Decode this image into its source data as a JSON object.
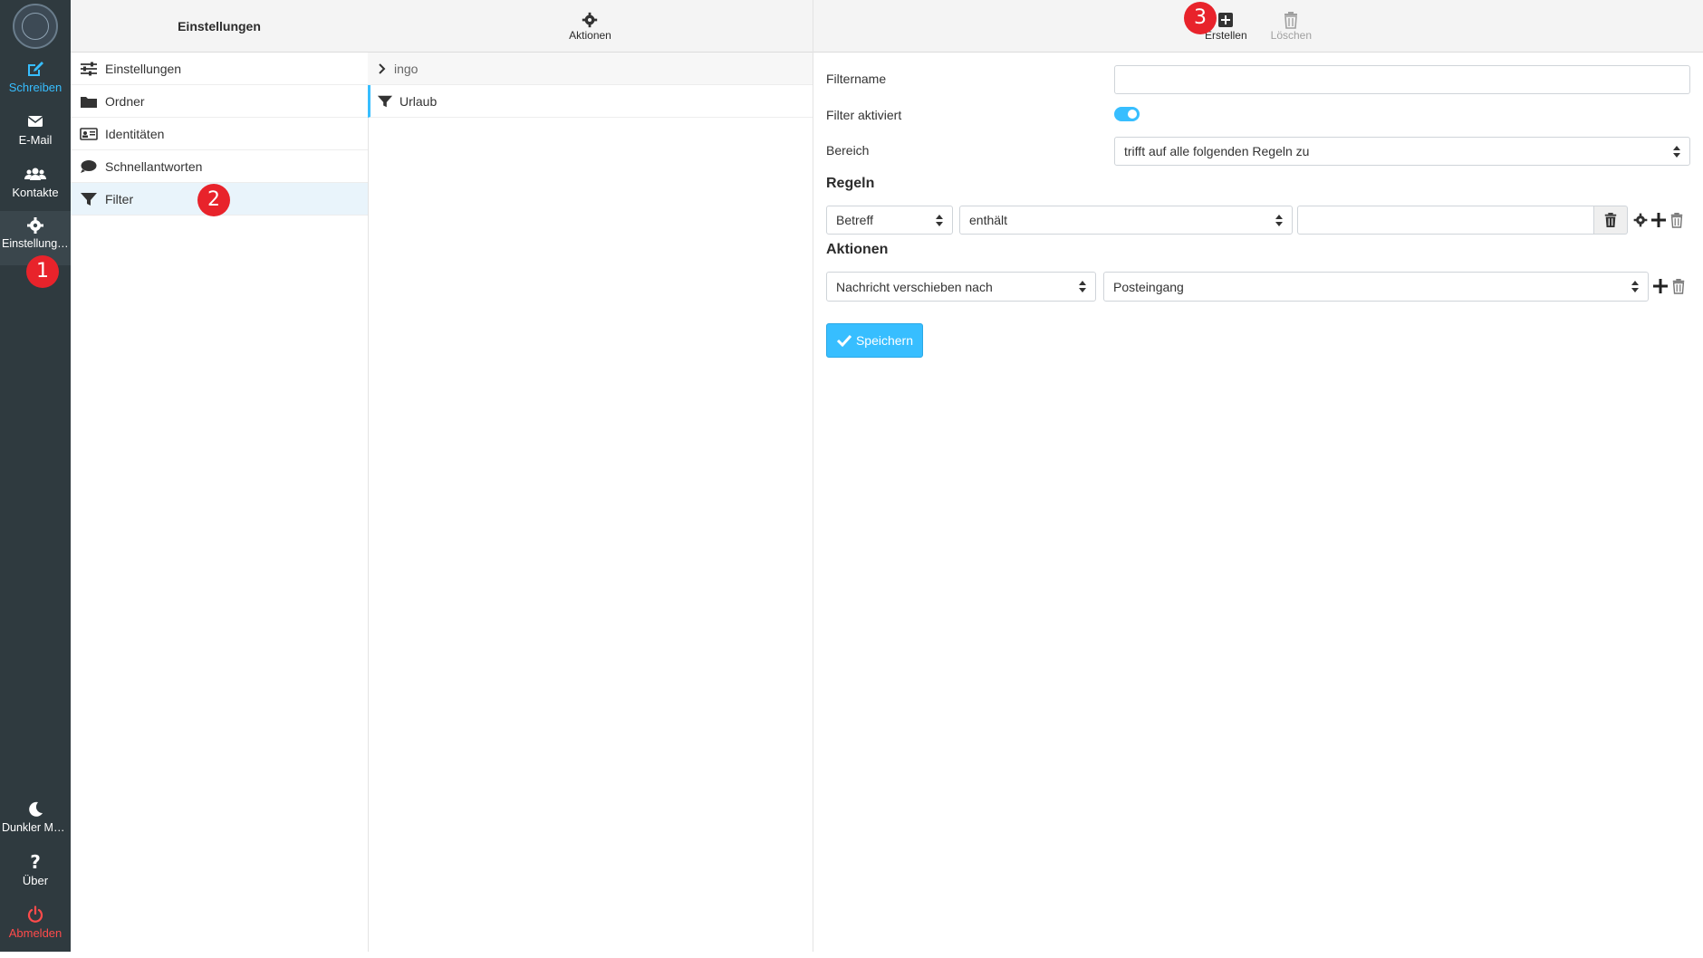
{
  "nav": {
    "items": [
      {
        "label": "Schreiben",
        "icon": "compose-icon",
        "color": "#37beff"
      },
      {
        "label": "E-Mail",
        "icon": "envelope-icon"
      },
      {
        "label": "Kontakte",
        "icon": "users-icon"
      },
      {
        "label": "Einstellungen",
        "icon": "gear-icon"
      }
    ],
    "bottom": [
      {
        "label": "Dunkler Mo...",
        "icon": "moon-icon"
      },
      {
        "label": "Über",
        "icon": "question-icon"
      },
      {
        "label": "Abmelden",
        "icon": "power-icon",
        "color": "#ff4b4b"
      }
    ]
  },
  "settings": {
    "title": "Einstellungen",
    "items": [
      {
        "label": "Einstellungen",
        "icon": "sliders-icon"
      },
      {
        "label": "Ordner",
        "icon": "folder-icon"
      },
      {
        "label": "Identitäten",
        "icon": "id-card-icon"
      },
      {
        "label": "Schnellantworten",
        "icon": "speech-bubble-icon"
      },
      {
        "label": "Filter",
        "icon": "filter-icon"
      }
    ]
  },
  "filters": {
    "toolbar": {
      "actions_label": "Aktionen"
    },
    "tree": [
      {
        "label": "ingo",
        "icon": "chevron-right-icon"
      },
      {
        "label": "Urlaub",
        "icon": "filter-icon"
      }
    ]
  },
  "main": {
    "toolbar": {
      "create_label": "Erstellen",
      "delete_label": "Löschen"
    },
    "form": {
      "filtername_label": "Filtername",
      "filtername_value": "",
      "active_label": "Filter aktiviert",
      "scope_label": "Bereich",
      "scope_value": "trifft auf alle folgenden Regeln zu",
      "rules_title": "Regeln",
      "rule_field": "Betreff",
      "rule_operator": "enthält",
      "rule_value": "",
      "actions_title": "Aktionen",
      "action_type": "Nachricht verschieben nach",
      "action_target": "Posteingang",
      "save_label": "Speichern"
    }
  },
  "markers": [
    "1",
    "2",
    "3"
  ],
  "colors": {
    "accent": "#37beff",
    "nav_bg": "#2f3a3f",
    "danger": "#ff4b4b",
    "marker": "#e8232b"
  }
}
